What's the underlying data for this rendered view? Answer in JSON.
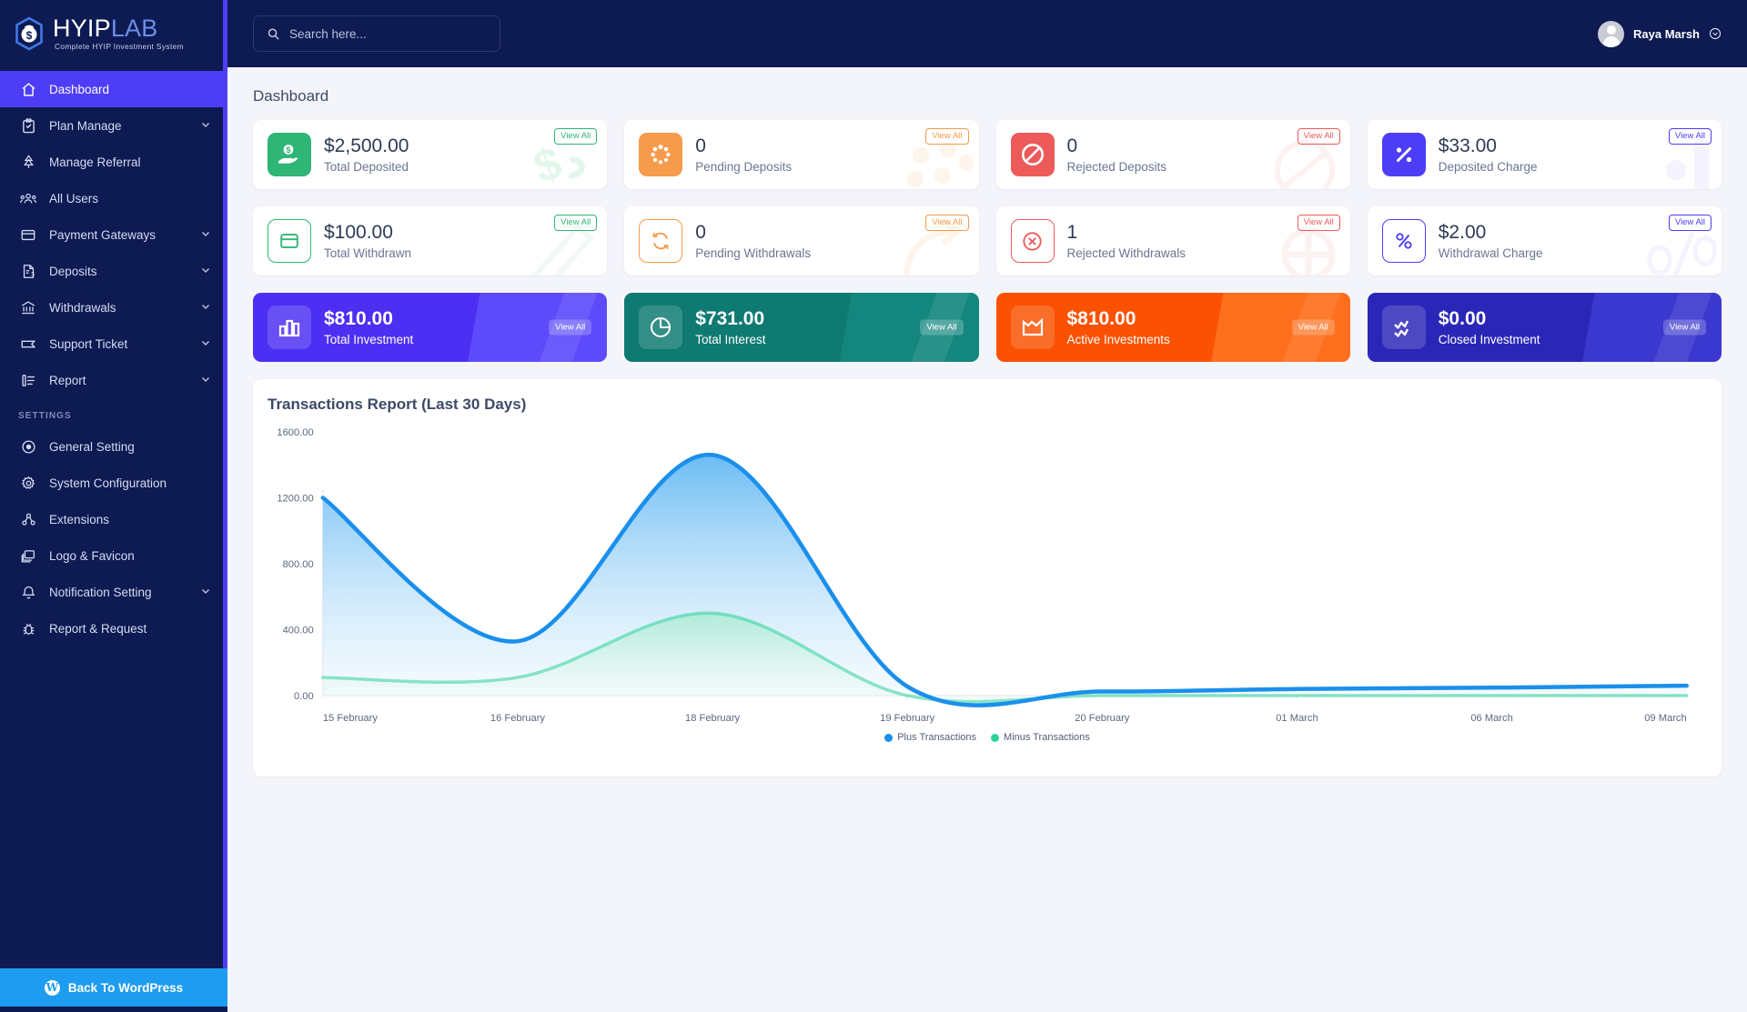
{
  "brand": {
    "name_part1": "HYIP",
    "name_part2": "LAB",
    "tagline": "Complete HYIP Investment System"
  },
  "topbar": {
    "search_placeholder": "Search here...",
    "search_value": "",
    "user_name": "Raya Marsh"
  },
  "sidebar": {
    "settings_heading": "SETTINGS",
    "items": [
      {
        "label": "Dashboard",
        "icon": "home-icon",
        "active": true,
        "caret": false
      },
      {
        "label": "Plan Manage",
        "icon": "clipboard-icon",
        "active": false,
        "caret": true
      },
      {
        "label": "Manage Referral",
        "icon": "referral-icon",
        "active": false,
        "caret": false
      },
      {
        "label": "All Users",
        "icon": "users-icon",
        "active": false,
        "caret": false
      },
      {
        "label": "Payment Gateways",
        "icon": "card-icon",
        "active": false,
        "caret": true
      },
      {
        "label": "Deposits",
        "icon": "invoice-icon",
        "active": false,
        "caret": true
      },
      {
        "label": "Withdrawals",
        "icon": "bank-icon",
        "active": false,
        "caret": true
      },
      {
        "label": "Support Ticket",
        "icon": "ticket-icon",
        "active": false,
        "caret": true
      },
      {
        "label": "Report",
        "icon": "list-icon",
        "active": false,
        "caret": true
      }
    ],
    "settings_items": [
      {
        "label": "General Setting",
        "icon": "target-icon",
        "caret": false
      },
      {
        "label": "System Configuration",
        "icon": "gear-icon",
        "caret": false
      },
      {
        "label": "Extensions",
        "icon": "extensions-icon",
        "caret": false
      },
      {
        "label": "Logo & Favicon",
        "icon": "images-icon",
        "caret": false
      },
      {
        "label": "Notification Setting",
        "icon": "bell-icon",
        "caret": true
      },
      {
        "label": "Report & Request",
        "icon": "bug-icon",
        "caret": false
      }
    ],
    "wordpress_button": "Back To WordPress"
  },
  "page": {
    "title": "Dashboard"
  },
  "stat_cards": [
    {
      "value": "$2,500.00",
      "label": "Total Deposited",
      "view_all": "View All",
      "color": "#2fb575",
      "style": "filled",
      "icon": "hand-money-icon"
    },
    {
      "value": "0",
      "label": "Pending Deposits",
      "view_all": "View All",
      "color": "#f59b4b",
      "style": "filled",
      "icon": "spinner-icon"
    },
    {
      "value": "0",
      "label": "Rejected Deposits",
      "view_all": "View All",
      "color": "#ec5a5a",
      "style": "filled",
      "icon": "ban-icon"
    },
    {
      "value": "$33.00",
      "label": "Deposited Charge",
      "view_all": "View All",
      "color": "#4d3df7",
      "style": "filled",
      "icon": "percent-badge-icon"
    },
    {
      "value": "$100.00",
      "label": "Total Withdrawn",
      "view_all": "View All",
      "color": "#2fb575",
      "style": "outline",
      "icon": "wallet-icon"
    },
    {
      "value": "0",
      "label": "Pending Withdrawals",
      "view_all": "View All",
      "color": "#f59b4b",
      "style": "outline",
      "icon": "refresh-icon"
    },
    {
      "value": "1",
      "label": "Rejected Withdrawals",
      "view_all": "View All",
      "color": "#ec5a5a",
      "style": "outline",
      "icon": "x-circle-icon"
    },
    {
      "value": "$2.00",
      "label": "Withdrawal Charge",
      "view_all": "View All",
      "color": "#4d3df7",
      "style": "outline",
      "icon": "percent-icon"
    }
  ],
  "gradient_cards": [
    {
      "value": "$810.00",
      "label": "Total Investment",
      "view_all": "View All",
      "color1": "#4d2ff3",
      "color2": "#5a3df8",
      "icon": "bar-chart-icon"
    },
    {
      "value": "$731.00",
      "label": "Total Interest",
      "view_all": "View All",
      "color1": "#0e7a72",
      "color2": "#13877e",
      "icon": "pie-chart-icon"
    },
    {
      "value": "$810.00",
      "label": "Active Investments",
      "view_all": "View All",
      "color1": "#fa5202",
      "color2": "#fd6a14",
      "icon": "area-chart-icon"
    },
    {
      "value": "$0.00",
      "label": "Closed Investment",
      "view_all": "View All",
      "color1": "#2a27b8",
      "color2": "#3b38cf",
      "icon": "zigzag-icon"
    }
  ],
  "chart_data": {
    "type": "area",
    "title": "Transactions Report (Last 30 Days)",
    "xlabel": "",
    "ylabel": "",
    "ylim": [
      0,
      1600
    ],
    "yticks": [
      "0.00",
      "400.00",
      "800.00",
      "1200.00",
      "1600.00"
    ],
    "grid": false,
    "legend_position": "bottom",
    "categories": [
      "15 February",
      "16 February",
      "18 February",
      "19 February",
      "20 February",
      "01 March",
      "06 March",
      "09 March"
    ],
    "series": [
      {
        "name": "Plus Transactions",
        "color": "#1a8fec",
        "values": [
          1200,
          330,
          1460,
          55,
          25,
          40,
          48,
          60
        ]
      },
      {
        "name": "Minus Transactions",
        "color": "#2fd39a",
        "values": [
          110,
          110,
          500,
          0,
          0,
          0,
          0,
          0
        ]
      }
    ]
  }
}
